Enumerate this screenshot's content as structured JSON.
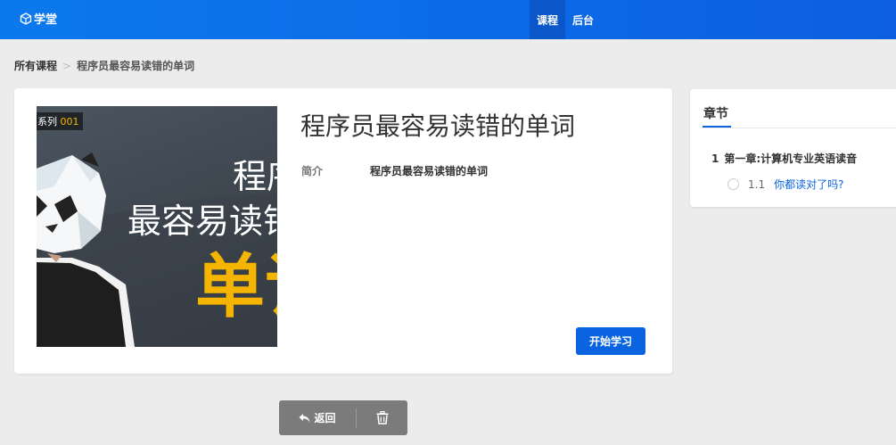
{
  "header": {
    "logo_text": "学堂",
    "nav": [
      {
        "label": "课程",
        "active": true
      },
      {
        "label": "后台",
        "active": false
      }
    ]
  },
  "breadcrumb": {
    "root": "所有课程",
    "separator": ">",
    "current": "程序员最容易读错的单词"
  },
  "course": {
    "title": "程序员最容易读错的单词",
    "intro_label": "简介",
    "intro_text": "程序员最容易读错的单词",
    "start_label": "开始学习",
    "cover": {
      "series_label": "系列",
      "series_number": "001",
      "line1": "程序",
      "line2": "最容易读错",
      "line3": "单词",
      "accent_color": "#f4b400"
    }
  },
  "chapters": {
    "tab_label": "章节",
    "items": [
      {
        "number": "1",
        "title": "第一章:计算机专业英语读音",
        "sections": [
          {
            "number": "1.1",
            "title": "你都读对了吗?"
          }
        ]
      }
    ]
  },
  "actions": {
    "back_label": "返回",
    "back_icon": "reply-arrow-icon",
    "delete_icon": "trash-icon"
  },
  "colors": {
    "primary": "#0a63e0",
    "header_gradient_start": "#0b79ee",
    "action_bar": "#7b7b7b"
  }
}
